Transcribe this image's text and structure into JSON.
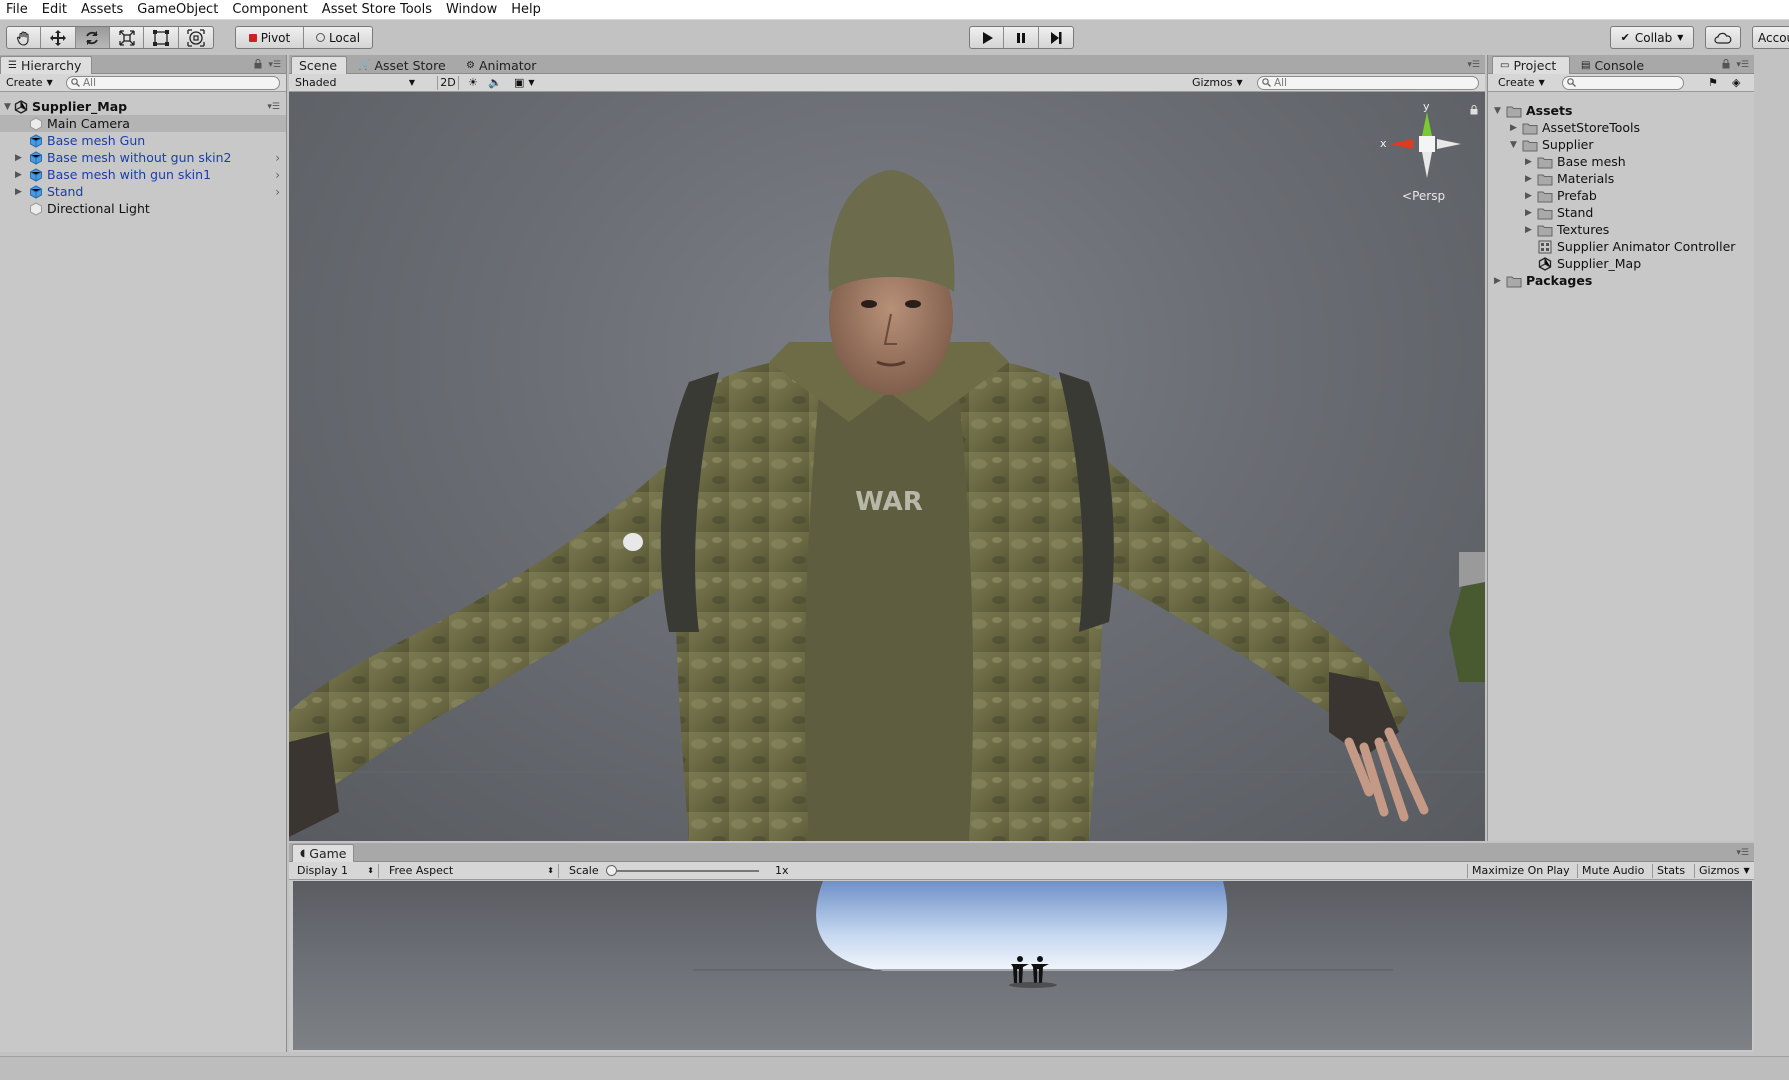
{
  "menu": [
    "File",
    "Edit",
    "Assets",
    "GameObject",
    "Component",
    "Asset Store Tools",
    "Window",
    "Help"
  ],
  "toolbar": {
    "tools": [
      "hand-tool-icon",
      "move-tool-icon",
      "rotate-tool-icon",
      "scale-tool-icon",
      "rect-tool-icon",
      "transform-tool-icon"
    ],
    "pivot": "Pivot",
    "local": "Local",
    "collab": "Collab",
    "account": "Accou"
  },
  "hierarchy": {
    "tab": "Hierarchy",
    "create": "Create",
    "search_placeholder": "All",
    "scene": "Supplier_Map",
    "items": [
      {
        "label": "Main Camera",
        "prefab": false,
        "expandable": false
      },
      {
        "label": "Base mesh Gun",
        "prefab": true,
        "expandable": false
      },
      {
        "label": "Base mesh without gun skin2",
        "prefab": true,
        "expandable": true
      },
      {
        "label": "Base mesh with gun skin1",
        "prefab": true,
        "expandable": true
      },
      {
        "label": "Stand",
        "prefab": true,
        "expandable": true
      },
      {
        "label": "Directional Light",
        "prefab": false,
        "expandable": false
      }
    ]
  },
  "scene": {
    "tabs": [
      "Scene",
      "Asset Store",
      "Animator"
    ],
    "shading": "Shaded",
    "mode_2d": "2D",
    "gizmos": "Gizmos",
    "search_placeholder": "All",
    "gizmo": {
      "y": "y",
      "x": "x",
      "persp": "Persp"
    },
    "shirt_text": "WAR"
  },
  "project": {
    "tabs": [
      "Project",
      "Console"
    ],
    "create": "Create",
    "tree": [
      {
        "label": "Assets",
        "level": 0,
        "type": "folder",
        "bold": true,
        "open": true
      },
      {
        "label": "AssetStoreTools",
        "level": 1,
        "type": "folder",
        "open": false
      },
      {
        "label": "Supplier",
        "level": 1,
        "type": "folder",
        "open": true
      },
      {
        "label": "Base mesh",
        "level": 2,
        "type": "folder",
        "open": false
      },
      {
        "label": "Materials",
        "level": 2,
        "type": "folder",
        "open": false
      },
      {
        "label": "Prefab",
        "level": 2,
        "type": "folder",
        "open": false
      },
      {
        "label": "Stand",
        "level": 2,
        "type": "folder",
        "open": false
      },
      {
        "label": "Textures",
        "level": 2,
        "type": "folder",
        "open": false
      },
      {
        "label": "Supplier Animator Controller",
        "level": 2,
        "type": "animator"
      },
      {
        "label": "Supplier_Map",
        "level": 2,
        "type": "scene"
      },
      {
        "label": "Packages",
        "level": 0,
        "type": "folder",
        "bold": true,
        "open": false
      }
    ]
  },
  "game": {
    "tab": "Game",
    "display": "Display 1",
    "aspect": "Free Aspect",
    "scale_label": "Scale",
    "scale_value": "1x",
    "maximize": "Maximize On Play",
    "mute": "Mute Audio",
    "stats": "Stats",
    "gizmos": "Gizmos"
  },
  "colors": {
    "prefab_text": "#1a3fa6",
    "panel_bg": "#c8c8c8",
    "tab_active": "#dedede",
    "scene_bg": "#6a6d73"
  }
}
